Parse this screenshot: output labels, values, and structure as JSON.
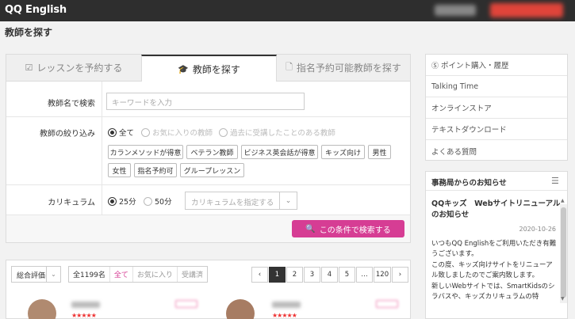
{
  "header": {
    "logo": "QQ English"
  },
  "page_title": "教師を探す",
  "tabs": [
    {
      "label": "レッスンを予約する"
    },
    {
      "label": "教師を探す"
    },
    {
      "label": "指名予約可能教師を探す"
    }
  ],
  "form": {
    "name_label": "教師名で検索",
    "name_placeholder": "キーワードを入力",
    "filter_label": "教師の絞り込み",
    "filter_options": [
      "全て",
      "お気に入りの教師",
      "過去に受講したことのある教師"
    ],
    "chips": [
      "カランメソッドが得意",
      "ベテラン教師",
      "ビジネス英会話が得意",
      "キッズ向け",
      "男性",
      "女性",
      "指名予約可",
      "グループレッスン"
    ],
    "curriculum_label": "カリキュラム",
    "duration_options": [
      "25分",
      "50分"
    ],
    "curriculum_placeholder": "カリキュラムを指定する",
    "search_button": "この条件で検索する"
  },
  "results": {
    "sort_label": "総合評価",
    "total": "全1199名",
    "filters": [
      "全て",
      "お気に入り",
      "受講済"
    ],
    "pages": [
      "1",
      "2",
      "3",
      "4",
      "5",
      "…",
      "120"
    ],
    "current_page": "1",
    "stars": "★★★★★"
  },
  "sidebar": {
    "menu": [
      "ポイント購入・履歴",
      "Talking Time",
      "オンラインストア",
      "テキストダウンロード",
      "よくある質問"
    ],
    "news_heading": "事務局からのお知らせ",
    "news_title": "QQキッズ　Webサイトリニューアルのお知らせ",
    "news_date": "2020-10-26",
    "news_body": [
      "いつもQQ Englishをご利用いただき有難うございます。",
      "この度、キッズ向けサイトをリニューアル致しましたのでご案内致します。",
      "新しいWebサイトでは、SmartKidsのシラバスや、キッズカリキュラムの特"
    ]
  },
  "colors": {
    "accent": "#d63d94",
    "header_bg": "#2e2e2e"
  }
}
